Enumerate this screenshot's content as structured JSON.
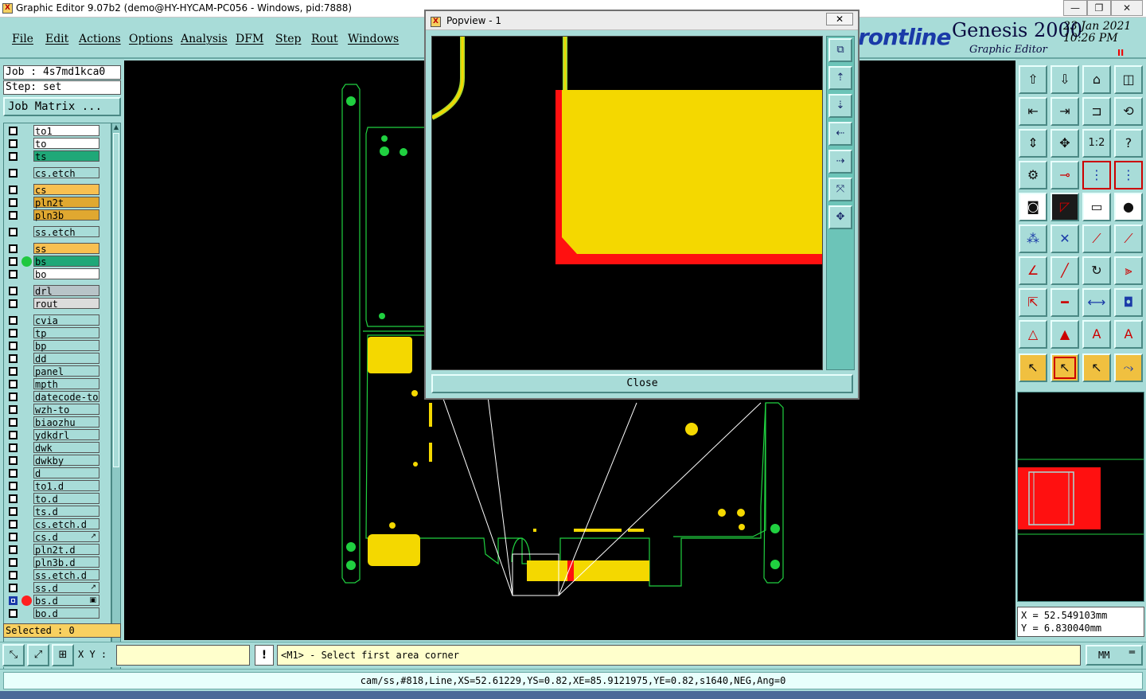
{
  "window": {
    "title": "Graphic Editor 9.07b2 (demo@HY-HYCAM-PC056 - Windows, pid:7888)",
    "min": "—",
    "max": "❐",
    "close": "✕"
  },
  "menu": [
    "File",
    "Edit",
    "Actions",
    "Options",
    "Analysis",
    "DFM",
    "Step",
    "Rout",
    "Windows"
  ],
  "brand": {
    "logo": "rontline",
    "product": "Genesis 2000",
    "subtitle": "Graphic Editor",
    "date": "23 Jan 2021",
    "time": "10:26 PM",
    "pause": "II"
  },
  "left": {
    "job": "Job : 4s7md1kca0",
    "step": "Step: set",
    "job_matrix": "Job Matrix ...",
    "selected": "Selected : 0"
  },
  "layers": [
    {
      "name": "to1",
      "color": "#ffffff",
      "gap": false
    },
    {
      "name": "to",
      "color": "#ffffff",
      "gap": false
    },
    {
      "name": "ts",
      "color": "#20a878",
      "gap": false
    },
    {
      "name": "cs.etch",
      "color": "#a8dcd8",
      "gap": true
    },
    {
      "name": "cs",
      "color": "#f8c050",
      "gap": true
    },
    {
      "name": "pln2t",
      "color": "#e0a830",
      "gap": false
    },
    {
      "name": "pln3b",
      "color": "#e0a830",
      "gap": false
    },
    {
      "name": "ss.etch",
      "color": "#a8dcd8",
      "gap": true
    },
    {
      "name": "ss",
      "color": "#f8c050",
      "gap": true
    },
    {
      "name": "bs",
      "color": "#20a878",
      "gap": false,
      "dot": "#20c840"
    },
    {
      "name": "bo",
      "color": "#ffffff",
      "gap": false
    },
    {
      "name": "drl",
      "color": "#b8c4c8",
      "gap": true
    },
    {
      "name": "rout",
      "color": "#dcdcdc",
      "gap": false
    },
    {
      "name": "cvia",
      "color": "#a8dcd8",
      "gap": true
    },
    {
      "name": "tp",
      "color": "#a8dcd8",
      "gap": false
    },
    {
      "name": "bp",
      "color": "#a8dcd8",
      "gap": false
    },
    {
      "name": "dd",
      "color": "#a8dcd8",
      "gap": false
    },
    {
      "name": "panel",
      "color": "#a8dcd8",
      "gap": false
    },
    {
      "name": "mpth",
      "color": "#a8dcd8",
      "gap": false
    },
    {
      "name": "datecode-to",
      "color": "#a8dcd8",
      "gap": false
    },
    {
      "name": "wzh-to",
      "color": "#a8dcd8",
      "gap": false
    },
    {
      "name": "biaozhu",
      "color": "#a8dcd8",
      "gap": false
    },
    {
      "name": "ydkdrl",
      "color": "#a8dcd8",
      "gap": false
    },
    {
      "name": "dwk",
      "color": "#a8dcd8",
      "gap": false
    },
    {
      "name": "dwkby",
      "color": "#a8dcd8",
      "gap": false
    },
    {
      "name": "d",
      "color": "#a8dcd8",
      "gap": false
    },
    {
      "name": "to1.d",
      "color": "#a8dcd8",
      "gap": false
    },
    {
      "name": "to.d",
      "color": "#a8dcd8",
      "gap": false
    },
    {
      "name": "ts.d",
      "color": "#a8dcd8",
      "gap": false
    },
    {
      "name": "cs.etch.d",
      "color": "#a8dcd8",
      "gap": false
    },
    {
      "name": "cs.d",
      "color": "#a8dcd8",
      "gap": false,
      "aux": "↗"
    },
    {
      "name": "pln2t.d",
      "color": "#a8dcd8",
      "gap": false
    },
    {
      "name": "pln3b.d",
      "color": "#a8dcd8",
      "gap": false
    },
    {
      "name": "ss.etch.d",
      "color": "#a8dcd8",
      "gap": false
    },
    {
      "name": "ss.d",
      "color": "#a8dcd8",
      "gap": false,
      "aux": "↗"
    },
    {
      "name": "bs.d",
      "color": "#a8dcd8",
      "gap": false,
      "dot": "#ff2020",
      "aux": "▣",
      "active": true
    },
    {
      "name": "bo.d",
      "color": "#a8dcd8",
      "gap": false
    }
  ],
  "popview": {
    "title": "Popview - 1",
    "close_x": "✕",
    "close_label": "Close"
  },
  "command": {
    "xy_label": "X Y :",
    "xy_value": "",
    "warn": "!",
    "prompt": "<M1> - Select first area corner",
    "units": "MM",
    "units_arrow": "═"
  },
  "coords": {
    "x": "X  = 52.549103mm",
    "y": "Y  = 6.830040mm"
  },
  "status": "cam/ss,#818,Line,XS=52.61229,YS=0.82,XE=85.9121975,YE=0.82,s1640,NEG,Ang=0",
  "colors": {
    "panel": "#a8dcd8",
    "pad_yellow": "#f4d800",
    "profile_green": "#20d040",
    "clearance_red": "#ff1010",
    "canvas": "#000000"
  }
}
